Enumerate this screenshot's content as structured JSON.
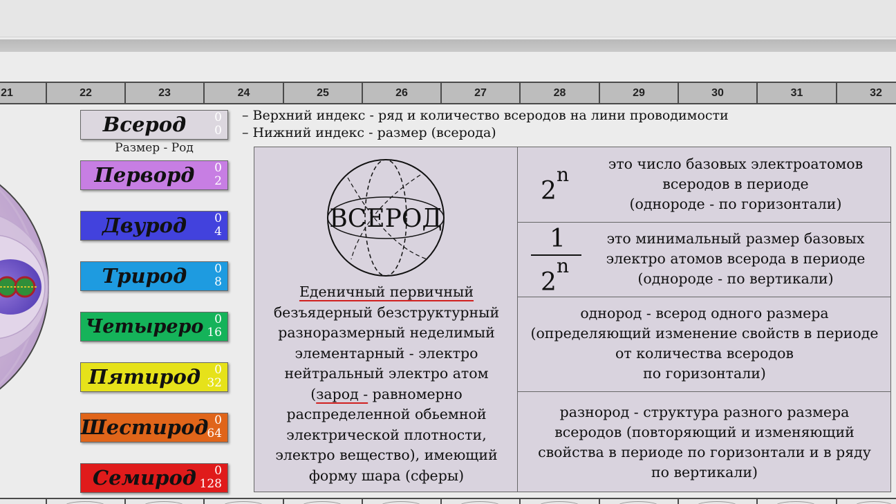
{
  "columns": [
    "21",
    "22",
    "23",
    "24",
    "25",
    "26",
    "27",
    "28",
    "29",
    "30",
    "31",
    "32"
  ],
  "legend": {
    "line1": "– Верхний индекс - ряд и количество всеродов на лини проводимости",
    "line2": "– Нижний индекс - размер (всерода)"
  },
  "size_label": "Размер - Род",
  "levels": [
    {
      "name": "Всерод",
      "sup": "0",
      "sub": "0",
      "color": "#dcd7df",
      "text_color": "#111111",
      "index_color": "#ffffff"
    },
    {
      "name": "Перворд",
      "sup": "0",
      "sub": "2",
      "color": "#c77ee3",
      "text_color": "#111111",
      "index_color": "#ffffff"
    },
    {
      "name": "Двурод",
      "sup": "0",
      "sub": "4",
      "color": "#4242dd",
      "text_color": "#111111",
      "index_color": "#ffffff"
    },
    {
      "name": "Трирод",
      "sup": "0",
      "sub": "8",
      "color": "#1e9be0",
      "text_color": "#111111",
      "index_color": "#ffffff"
    },
    {
      "name": "Четыреро",
      "sup": "0",
      "sub": "16",
      "color": "#15b35a",
      "text_color": "#111111",
      "index_color": "#ffffff"
    },
    {
      "name": "Пятирод",
      "sup": "0",
      "sub": "32",
      "color": "#e6e21a",
      "text_color": "#111111",
      "index_color": "#ffffff"
    },
    {
      "name": "Шестирод",
      "sup": "0",
      "sub": "64",
      "color": "#e0651a",
      "text_color": "#111111",
      "index_color": "#ffffff"
    },
    {
      "name": "Семирод",
      "sup": "0",
      "sub": "128",
      "color": "#e01b1b",
      "text_color": "#111111",
      "index_color": "#ffffff"
    }
  ],
  "sphere_label": "ВСЕРОД",
  "description": {
    "heading": "Еденичный первичный",
    "line1": "безъядерный безструктурный",
    "line2": "разноразмерный неделимый",
    "line3": "элементарный - электро",
    "line4": "нейтральный электро атом",
    "line5_open": "(",
    "line5_word": "зарод -",
    "line5_rest": " равномерно",
    "line6": "распределенной обьемной",
    "line7": "электрической плотности,",
    "line8": "электро вещество), имеющий",
    "line9": "форму шара (сферы)"
  },
  "formula1": {
    "base": "2",
    "exp": "n",
    "text": [
      "это число базовых электроатомов",
      "всеродов в периоде",
      "(однороде - по горизонтали)"
    ]
  },
  "formula2": {
    "numerator": "1",
    "base": "2",
    "exp": "n",
    "text": [
      "это минимальный размер базовых",
      "электро атомов всерода в периоде",
      "(однороде -  по вертикали)"
    ]
  },
  "odnorod": [
    "однород - всерод одного размера",
    "(определяющий изменение свойств в периоде",
    "от количества всеродов",
    "по горизонтали)"
  ],
  "raznorod": [
    "разнород - структура разного размера",
    "всеродов (повторяющий и изменяющий",
    "свойства в периоде по горизонтали и в ряду",
    "по вертикали)"
  ]
}
